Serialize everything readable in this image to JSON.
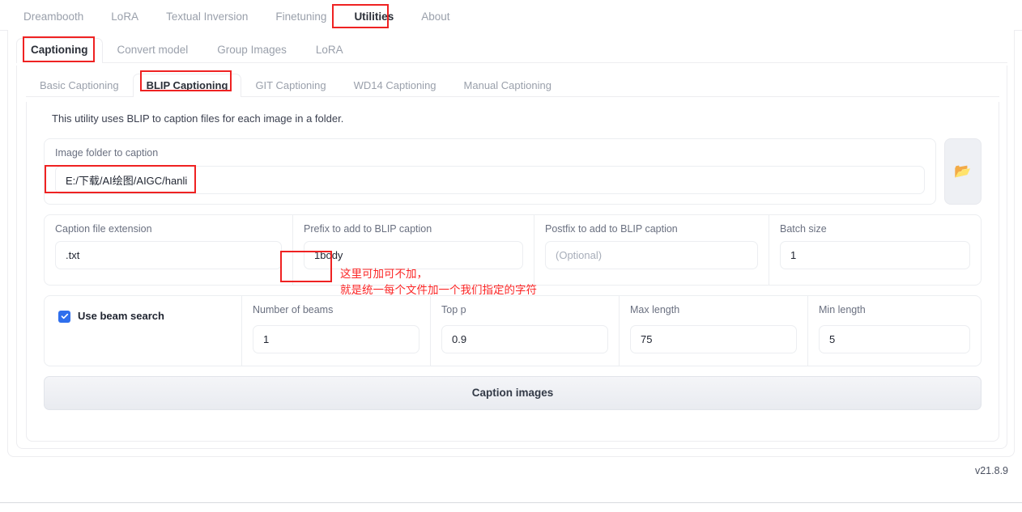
{
  "topnav": {
    "items": [
      {
        "label": "Dreambooth",
        "active": false
      },
      {
        "label": "LoRA",
        "active": false
      },
      {
        "label": "Textual Inversion",
        "active": false
      },
      {
        "label": "Finetuning",
        "active": false
      },
      {
        "label": "Utilities",
        "active": true
      },
      {
        "label": "About",
        "active": false
      }
    ]
  },
  "tabs_level2": {
    "items": [
      {
        "label": "Captioning",
        "active": true
      },
      {
        "label": "Convert model",
        "active": false
      },
      {
        "label": "Group Images",
        "active": false
      },
      {
        "label": "LoRA",
        "active": false
      }
    ]
  },
  "tabs_level3": {
    "items": [
      {
        "label": "Basic Captioning",
        "active": false
      },
      {
        "label": "BLIP Captioning",
        "active": true
      },
      {
        "label": "GIT Captioning",
        "active": false
      },
      {
        "label": "WD14 Captioning",
        "active": false
      },
      {
        "label": "Manual Captioning",
        "active": false
      }
    ]
  },
  "content": {
    "description": "This utility uses BLIP to caption files for each image in a folder.",
    "image_folder": {
      "label": "Image folder to caption",
      "value": "E:/下载/AI绘图/AIGC/hanli",
      "placeholder": ""
    },
    "folder_button": {
      "icon": "open-folder-icon",
      "glyph": "📂"
    },
    "fields_row": [
      {
        "label": "Caption file extension",
        "value": ".txt",
        "placeholder": "",
        "is_placeholder": false
      },
      {
        "label": "Prefix to add to BLIP caption",
        "value": "1body",
        "placeholder": "",
        "is_placeholder": false
      },
      {
        "label": "Postfix to add to BLIP caption",
        "value": "(Optional)",
        "placeholder": "(Optional)",
        "is_placeholder": true
      },
      {
        "label": "Batch size",
        "value": "1",
        "placeholder": "",
        "is_placeholder": false
      }
    ],
    "beam": {
      "checkbox_label": "Use beam search",
      "checked": true,
      "fields": [
        {
          "label": "Number of beams",
          "value": "1"
        },
        {
          "label": "Top p",
          "value": "0.9"
        },
        {
          "label": "Max length",
          "value": "75"
        },
        {
          "label": "Min length",
          "value": "5"
        }
      ]
    },
    "caption_button": {
      "label": "Caption images"
    }
  },
  "footer": {
    "version": "v21.8.9"
  },
  "annotations": {
    "note_line1": "这里可加可不加，",
    "note_line2": "就是统一每个文件加一个我们指定的字符"
  },
  "colors": {
    "accent": "#2f6fed",
    "annotation": "#fb2626",
    "text": "#1f2430",
    "muted": "#9aa0ab",
    "border": "#ededf0"
  }
}
